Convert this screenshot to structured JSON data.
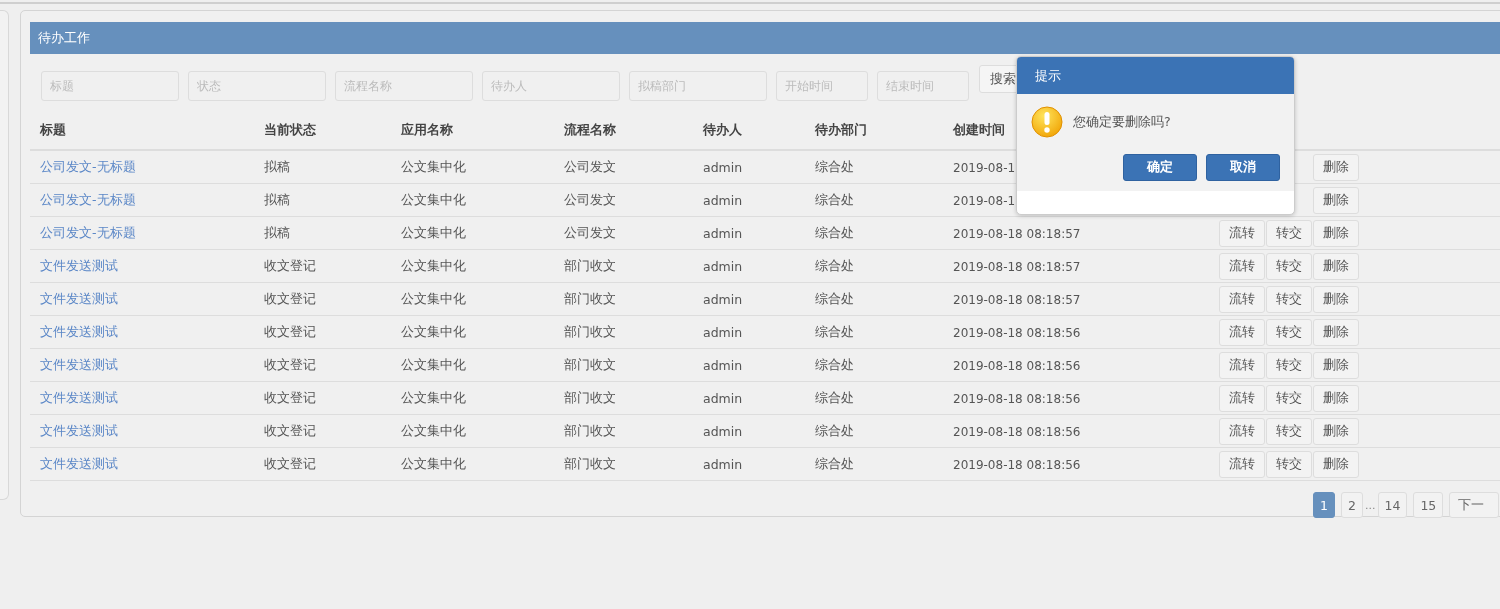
{
  "panel": {
    "title": "待办工作"
  },
  "filters": [
    {
      "placeholder": "标题"
    },
    {
      "placeholder": "状态"
    },
    {
      "placeholder": "流程名称"
    },
    {
      "placeholder": "待办人"
    },
    {
      "placeholder": "拟稿部门"
    },
    {
      "placeholder": "开始时间"
    },
    {
      "placeholder": "结束时间"
    }
  ],
  "search_button": "搜索",
  "table": {
    "columns": [
      "标题",
      "当前状态",
      "应用名称",
      "流程名称",
      "待办人",
      "待办部门",
      "创建时间"
    ],
    "rows": [
      {
        "cells": [
          "公司发文-无标题",
          "拟稿",
          "公文集中化",
          "公司发文",
          "admin",
          "综合处",
          "2019-08-1"
        ],
        "actions": [
          "删除"
        ]
      },
      {
        "cells": [
          "公司发文-无标题",
          "拟稿",
          "公文集中化",
          "公司发文",
          "admin",
          "综合处",
          "2019-08-1"
        ],
        "actions": [
          "删除"
        ]
      },
      {
        "cells": [
          "公司发文-无标题",
          "拟稿",
          "公文集中化",
          "公司发文",
          "admin",
          "综合处",
          "2019-08-18 08:18:57"
        ],
        "actions": [
          "流转",
          "转交",
          "删除"
        ]
      },
      {
        "cells": [
          "文件发送测试",
          "收文登记",
          "公文集中化",
          "部门收文",
          "admin",
          "综合处",
          "2019-08-18 08:18:57"
        ],
        "actions": [
          "流转",
          "转交",
          "删除"
        ]
      },
      {
        "cells": [
          "文件发送测试",
          "收文登记",
          "公文集中化",
          "部门收文",
          "admin",
          "综合处",
          "2019-08-18 08:18:57"
        ],
        "actions": [
          "流转",
          "转交",
          "删除"
        ]
      },
      {
        "cells": [
          "文件发送测试",
          "收文登记",
          "公文集中化",
          "部门收文",
          "admin",
          "综合处",
          "2019-08-18 08:18:56"
        ],
        "actions": [
          "流转",
          "转交",
          "删除"
        ]
      },
      {
        "cells": [
          "文件发送测试",
          "收文登记",
          "公文集中化",
          "部门收文",
          "admin",
          "综合处",
          "2019-08-18 08:18:56"
        ],
        "actions": [
          "流转",
          "转交",
          "删除"
        ]
      },
      {
        "cells": [
          "文件发送测试",
          "收文登记",
          "公文集中化",
          "部门收文",
          "admin",
          "综合处",
          "2019-08-18 08:18:56"
        ],
        "actions": [
          "流转",
          "转交",
          "删除"
        ]
      },
      {
        "cells": [
          "文件发送测试",
          "收文登记",
          "公文集中化",
          "部门收文",
          "admin",
          "综合处",
          "2019-08-18 08:18:56"
        ],
        "actions": [
          "流转",
          "转交",
          "删除"
        ]
      },
      {
        "cells": [
          "文件发送测试",
          "收文登记",
          "公文集中化",
          "部门收文",
          "admin",
          "综合处",
          "2019-08-18 08:18:56"
        ],
        "actions": [
          "流转",
          "转交",
          "删除"
        ]
      }
    ]
  },
  "pagination": [
    {
      "label": "1",
      "kind": "page",
      "selected": true
    },
    {
      "label": "2",
      "kind": "page",
      "selected": false
    },
    {
      "label": "...",
      "kind": "gap",
      "selected": false
    },
    {
      "label": "14",
      "kind": "page",
      "selected": false
    },
    {
      "label": "15",
      "kind": "page",
      "selected": false
    },
    {
      "label": "下一",
      "kind": "next",
      "selected": false
    }
  ],
  "dialog": {
    "title": "提示",
    "message": "您确定要删除吗?",
    "buttons": [
      "确定",
      "取消"
    ]
  }
}
